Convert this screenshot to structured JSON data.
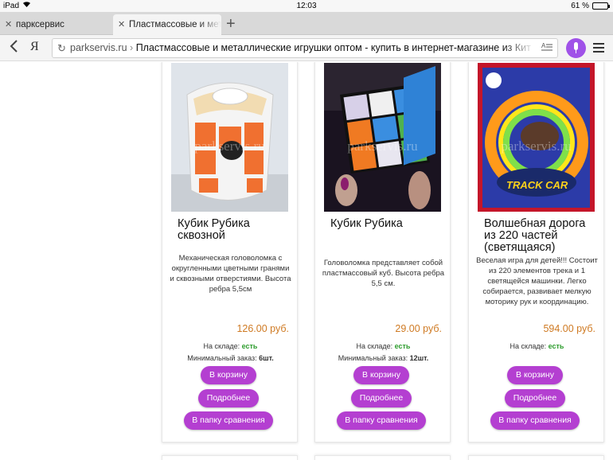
{
  "status": {
    "device": "iPad",
    "time": "12:03",
    "battery": "61 %",
    "battery_level": 0.61
  },
  "tabs": [
    {
      "label": "паркcервис"
    },
    {
      "label": "Пластмассовые и метал"
    }
  ],
  "address": {
    "yandex_label": "Я",
    "domain": "parkservis.ru",
    "separator": "›",
    "page_title": "Пластмассовые и металлические игрушки оптом - купить в интернет-магазине из Кит",
    "translate_label": "A̲ ═"
  },
  "watermark": "parkservis.ru",
  "labels": {
    "stock": "На складе:",
    "stock_value": "есть",
    "min_order": "Минимальный заказ:",
    "cart": "В корзину",
    "more": "Подробнее",
    "compare": "В папку сравнения"
  },
  "products": [
    {
      "title": "Кубик Рубика сквозной",
      "description": "Механическая головоломка с округленными цветными гранями и сквозными отверстиями. Высота ребра 5,5см",
      "price": "126.00 руб.",
      "min_order": "6шт."
    },
    {
      "title": "Кубик Рубика",
      "description": "Головоломка представляет собой пластмассовый куб. Высота ребра 5,5 см.",
      "price": "29.00 руб.",
      "min_order": "12шт."
    },
    {
      "title": "Волшебная дорога из 220 частей (светящаяся)",
      "description": "Веселая игра для детей!!! Состоит из 220 элементов трека и 1 светящейся машинки. Легко собирается, развивает мелкую моторику рук и координацию.",
      "price": "594.00 руб.",
      "min_order": "",
      "box_text": "TRACK CAR"
    }
  ],
  "colors": {
    "accent": "#b43fd1",
    "price": "#cf7a23",
    "stock": "#2f9d2f",
    "mic": "#a052e8"
  }
}
